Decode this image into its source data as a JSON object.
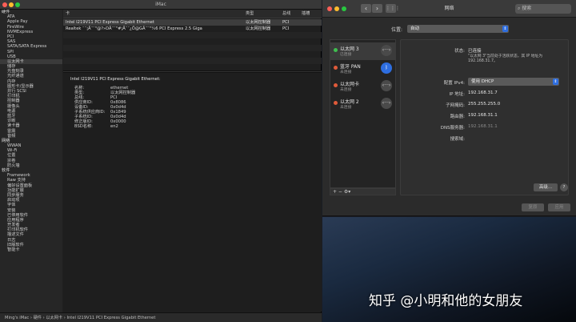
{
  "sysinfo": {
    "title": "iMac",
    "sidebar": [
      {
        "label": "硬件",
        "cat": true
      },
      {
        "label": "ATA"
      },
      {
        "label": "Apple Pay"
      },
      {
        "label": "FireWire"
      },
      {
        "label": "NVMExpress"
      },
      {
        "label": "PCI"
      },
      {
        "label": "SAS"
      },
      {
        "label": "SATA/SATA Express"
      },
      {
        "label": "SPI"
      },
      {
        "label": "USB"
      },
      {
        "label": "以太网卡",
        "sel": true
      },
      {
        "label": "储存"
      },
      {
        "label": "光盘刻录"
      },
      {
        "label": "光纤通道"
      },
      {
        "label": "内存"
      },
      {
        "label": "图形卡/显示器"
      },
      {
        "label": "并行 SCSI"
      },
      {
        "label": "打印机"
      },
      {
        "label": "控制器"
      },
      {
        "label": "摄像头"
      },
      {
        "label": "电源"
      },
      {
        "label": "蓝牙"
      },
      {
        "label": "诊断"
      },
      {
        "label": "读卡器"
      },
      {
        "label": "雷雳"
      },
      {
        "label": "音频"
      },
      {
        "label": "网络",
        "cat": true
      },
      {
        "label": "WWAN"
      },
      {
        "label": "Wi-Fi"
      },
      {
        "label": "位置"
      },
      {
        "label": "宗卷"
      },
      {
        "label": "防火墙"
      },
      {
        "label": "软件",
        "cat": true
      },
      {
        "label": "Framework"
      },
      {
        "label": "Raw 支持"
      },
      {
        "label": "偏好设置面板"
      },
      {
        "label": "功能扩展"
      },
      {
        "label": "同步服务"
      },
      {
        "label": "启动项"
      },
      {
        "label": "字体"
      },
      {
        "label": "安装"
      },
      {
        "label": "已停用软件"
      },
      {
        "label": "应用程序"
      },
      {
        "label": "开发者"
      },
      {
        "label": "打印机软件"
      },
      {
        "label": "描述文件"
      },
      {
        "label": "日志"
      },
      {
        "label": "旧版软件"
      },
      {
        "label": "智能卡"
      }
    ],
    "columns": [
      "卡",
      "类型",
      "总线",
      "插槽"
    ],
    "rows": [
      {
        "card": "Intel I219V11 PCI Express Gigabit Ethernet",
        "type": "以太网控制器",
        "bus": "PCI",
        "slot": ""
      },
      {
        "card": "Realtek ¨¨¦Ä¨¨\"@?»DÂ¨¨\"#¦Ä¨¨¿Ö@GÂ¨¨\"¼6 PCI Express 2.5 Giga",
        "type": "以太网控制器",
        "bus": "PCI",
        "slot": ""
      }
    ],
    "detail_title": "Intel I219V11 PCI Express Gigabit Ethernet:",
    "detail": [
      {
        "k": "名称:",
        "v": "ethernet"
      },
      {
        "k": "类型:",
        "v": "以太网控制器"
      },
      {
        "k": "总线:",
        "v": "PCI"
      },
      {
        "k": "供应商ID:",
        "v": "0x8086"
      },
      {
        "k": "设备ID:",
        "v": "0x0d4d"
      },
      {
        "k": "子系统供应商ID:",
        "v": "0x1849"
      },
      {
        "k": "子系统ID:",
        "v": "0x0d4d"
      },
      {
        "k": "修正版ID:",
        "v": "0x0000"
      },
      {
        "k": "BSD名称:",
        "v": "en2"
      }
    ],
    "status": "Ming's iMac › 硬件 › 以太网卡 › Intel I219V11 PCI Express Gigabit Ethernet"
  },
  "network": {
    "title": "网络",
    "search_placeholder": "搜索",
    "location_label": "位置:",
    "location_value": "自动",
    "services": [
      {
        "name": "以太网 3",
        "sub": "已连接",
        "color": "#3fbf4f",
        "icon": "‹···›"
      },
      {
        "name": "蓝牙 PAN",
        "sub": "未连接",
        "color": "#e05a3a",
        "icon": "ᛒ"
      },
      {
        "name": "以太网卡",
        "sub": "未连接",
        "color": "#e05a3a",
        "icon": "‹···›"
      },
      {
        "name": "以太网 2",
        "sub": "未连接",
        "color": "#e05a3a",
        "icon": "‹···›"
      }
    ],
    "list_buttons": "+ − ⚙▾",
    "status_label": "状态:",
    "status_value": "已连接",
    "status_desc": "\"以太网 3\"当前处于活跃状态，其 IP 地址为 192.168.31.7。",
    "config_label": "配置 IPv4:",
    "config_value": "使用 DHCP",
    "ip_label": "IP 地址:",
    "ip_value": "192.168.31.7",
    "mask_label": "子网掩码:",
    "mask_value": "255.255.255.0",
    "router_label": "路由器:",
    "router_value": "192.168.31.1",
    "dns_label": "DNS服务器:",
    "dns_value": "192.168.31.1",
    "search_domain_label": "搜索域:",
    "advanced_btn": "高级...",
    "help_btn": "?",
    "revert_btn": "复原",
    "apply_btn": "应用"
  },
  "watermark": "知乎 @小明和他的女朋友"
}
